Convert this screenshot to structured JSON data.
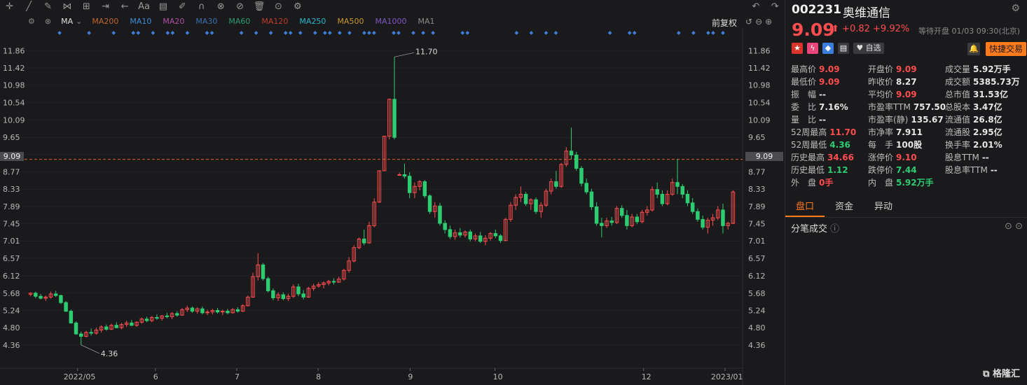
{
  "toolbar": {
    "icons": [
      "crosshair-icon",
      "line-tool-icon",
      "pen-tool-icon",
      "pattern-tool-icon",
      "measure-icon",
      "range-icon",
      "arrow-tool-icon",
      "text-tool-icon",
      "note-icon",
      "brush-icon",
      "magnet-icon",
      "link-icon",
      "hide-icon",
      "trash-icon",
      "compare-icon",
      "settings-icon"
    ],
    "text_label": "Aa"
  },
  "ma_bar": {
    "type_label": "MA",
    "items": [
      {
        "label": "MA200",
        "color": "#c0652e"
      },
      {
        "label": "MA10",
        "color": "#3e8fd6"
      },
      {
        "label": "MA20",
        "color": "#b04fa3"
      },
      {
        "label": "MA30",
        "color": "#3c6fb0"
      },
      {
        "label": "MA60",
        "color": "#2e9e6e"
      },
      {
        "label": "MA120",
        "color": "#c0392b"
      },
      {
        "label": "MA250",
        "color": "#2ab7c9"
      },
      {
        "label": "MA500",
        "color": "#c8962e"
      },
      {
        "label": "MA1000",
        "color": "#7e57c2"
      },
      {
        "label": "MA1",
        "color": "#8a8a8a"
      }
    ],
    "adjust_label": "前复权"
  },
  "chart_data": {
    "type": "candlestick",
    "title": "",
    "y_ticks": [
      11.86,
      11.42,
      10.98,
      10.54,
      10.09,
      9.65,
      9.21,
      8.77,
      8.33,
      7.89,
      7.45,
      7.01,
      6.57,
      6.12,
      5.68,
      5.24,
      4.8,
      4.36
    ],
    "ylim": [
      4.16,
      12.08
    ],
    "x_ticks": [
      "2022/05",
      "6",
      "7",
      "8",
      "9",
      "10",
      "12",
      "2023/01"
    ],
    "current_price_label": "9.09",
    "annotations": [
      {
        "label": "11.70"
      },
      {
        "label": "4.36"
      }
    ],
    "colors": {
      "up": "#ff4d4f",
      "down": "#2ecc71",
      "marker": "#3f7fd9",
      "grid": "#2a2a2e"
    },
    "ohlc": [
      [
        5.65,
        5.7,
        5.6,
        5.68
      ],
      [
        5.68,
        5.72,
        5.55,
        5.6
      ],
      [
        5.6,
        5.66,
        5.52,
        5.55
      ],
      [
        5.55,
        5.62,
        5.48,
        5.58
      ],
      [
        5.58,
        5.72,
        5.54,
        5.66
      ],
      [
        5.66,
        5.74,
        5.58,
        5.62
      ],
      [
        5.62,
        5.64,
        5.4,
        5.44
      ],
      [
        5.44,
        5.48,
        5.2,
        5.22
      ],
      [
        5.22,
        5.26,
        4.9,
        4.92
      ],
      [
        4.92,
        4.96,
        4.62,
        4.64
      ],
      [
        4.64,
        4.7,
        4.36,
        4.58
      ],
      [
        4.58,
        4.72,
        4.55,
        4.68
      ],
      [
        4.68,
        4.78,
        4.6,
        4.66
      ],
      [
        4.66,
        4.8,
        4.62,
        4.74
      ],
      [
        4.74,
        4.86,
        4.68,
        4.82
      ],
      [
        4.82,
        4.88,
        4.72,
        4.76
      ],
      [
        4.76,
        4.9,
        4.74,
        4.86
      ],
      [
        4.86,
        4.94,
        4.78,
        4.8
      ],
      [
        4.8,
        4.92,
        4.76,
        4.88
      ],
      [
        4.88,
        4.98,
        4.82,
        4.92
      ],
      [
        4.92,
        5.0,
        4.84,
        4.86
      ],
      [
        4.86,
        4.96,
        4.82,
        4.94
      ],
      [
        4.94,
        5.06,
        4.9,
        5.02
      ],
      [
        5.02,
        5.08,
        4.94,
        4.98
      ],
      [
        4.98,
        5.1,
        4.94,
        5.06
      ],
      [
        5.06,
        5.14,
        5.0,
        5.04
      ],
      [
        5.04,
        5.12,
        4.98,
        5.1
      ],
      [
        5.1,
        5.18,
        5.04,
        5.08
      ],
      [
        5.08,
        5.2,
        5.02,
        5.16
      ],
      [
        5.16,
        5.22,
        5.08,
        5.12
      ],
      [
        5.12,
        5.3,
        5.1,
        5.26
      ],
      [
        5.26,
        5.36,
        5.2,
        5.3
      ],
      [
        5.3,
        5.34,
        5.18,
        5.22
      ],
      [
        5.22,
        5.32,
        5.16,
        5.28
      ],
      [
        5.28,
        5.34,
        5.14,
        5.18
      ],
      [
        5.18,
        5.26,
        5.12,
        5.2
      ],
      [
        5.2,
        5.28,
        5.14,
        5.24
      ],
      [
        5.24,
        5.3,
        5.16,
        5.2
      ],
      [
        5.2,
        5.26,
        5.12,
        5.22
      ],
      [
        5.22,
        5.28,
        5.14,
        5.18
      ],
      [
        5.18,
        5.3,
        5.16,
        5.26
      ],
      [
        5.26,
        5.32,
        5.18,
        5.22
      ],
      [
        5.22,
        5.4,
        5.2,
        5.36
      ],
      [
        5.36,
        5.62,
        5.34,
        5.58
      ],
      [
        5.58,
        6.2,
        5.56,
        6.1
      ],
      [
        6.1,
        6.7,
        6.0,
        6.4
      ],
      [
        6.4,
        6.45,
        6.0,
        6.05
      ],
      [
        6.05,
        6.1,
        5.7,
        5.74
      ],
      [
        5.74,
        5.8,
        5.5,
        5.56
      ],
      [
        5.56,
        5.7,
        5.48,
        5.64
      ],
      [
        5.64,
        5.7,
        5.5,
        5.54
      ],
      [
        5.54,
        5.66,
        5.48,
        5.6
      ],
      [
        5.6,
        5.9,
        5.56,
        5.84
      ],
      [
        5.84,
        5.92,
        5.6,
        5.66
      ],
      [
        5.66,
        5.76,
        5.52,
        5.58
      ],
      [
        5.58,
        5.84,
        5.56,
        5.8
      ],
      [
        5.8,
        5.92,
        5.74,
        5.86
      ],
      [
        5.86,
        5.96,
        5.82,
        5.9
      ],
      [
        5.9,
        5.98,
        5.8,
        5.94
      ],
      [
        5.94,
        6.02,
        5.88,
        5.98
      ],
      [
        5.98,
        6.06,
        5.9,
        5.96
      ],
      [
        5.96,
        6.1,
        5.94,
        6.04
      ],
      [
        6.04,
        6.3,
        6.0,
        6.26
      ],
      [
        6.26,
        6.6,
        6.2,
        6.5
      ],
      [
        6.5,
        6.9,
        6.46,
        6.84
      ],
      [
        6.84,
        7.1,
        6.8,
        7.06
      ],
      [
        7.06,
        7.3,
        6.9,
        6.96
      ],
      [
        6.96,
        7.5,
        6.94,
        7.4
      ],
      [
        7.4,
        8.1,
        7.36,
        8.0
      ],
      [
        8.0,
        8.8,
        7.98,
        8.8
      ],
      [
        8.8,
        9.68,
        8.8,
        9.68
      ],
      [
        9.68,
        10.64,
        9.6,
        10.62
      ],
      [
        10.62,
        11.7,
        9.6,
        9.65
      ],
      [
        8.7,
        8.75,
        8.7,
        8.7
      ],
      [
        8.7,
        8.98,
        8.6,
        8.66
      ],
      [
        8.66,
        8.76,
        8.1,
        8.24
      ],
      [
        8.24,
        8.5,
        8.1,
        8.4
      ],
      [
        8.4,
        8.56,
        8.3,
        8.52
      ],
      [
        8.52,
        8.56,
        8.1,
        8.16
      ],
      [
        8.16,
        8.2,
        7.7,
        7.76
      ],
      [
        7.76,
        8.0,
        7.6,
        7.9
      ],
      [
        7.9,
        7.98,
        7.4,
        7.46
      ],
      [
        7.46,
        7.54,
        7.2,
        7.3
      ],
      [
        7.3,
        7.4,
        7.06,
        7.12
      ],
      [
        7.12,
        7.3,
        7.04,
        7.22
      ],
      [
        7.22,
        7.34,
        7.1,
        7.16
      ],
      [
        7.16,
        7.28,
        7.1,
        7.24
      ],
      [
        7.24,
        7.3,
        7.0,
        7.06
      ],
      [
        7.06,
        7.2,
        7.0,
        7.14
      ],
      [
        7.14,
        7.24,
        6.96,
        7.0
      ],
      [
        7.0,
        7.16,
        6.9,
        7.08
      ],
      [
        7.08,
        7.24,
        7.02,
        7.2
      ],
      [
        7.2,
        7.3,
        7.08,
        7.14
      ],
      [
        7.14,
        7.18,
        6.96,
        7.02
      ],
      [
        7.02,
        7.6,
        7.0,
        7.56
      ],
      [
        7.56,
        8.0,
        7.5,
        7.92
      ],
      [
        7.92,
        8.2,
        7.8,
        8.12
      ],
      [
        8.12,
        8.4,
        8.0,
        8.2
      ],
      [
        8.2,
        8.26,
        7.9,
        7.96
      ],
      [
        7.96,
        8.1,
        7.8,
        8.06
      ],
      [
        8.06,
        8.12,
        7.7,
        7.76
      ],
      [
        7.76,
        8.0,
        7.6,
        7.92
      ],
      [
        7.92,
        8.34,
        7.88,
        8.28
      ],
      [
        8.28,
        8.6,
        8.2,
        8.52
      ],
      [
        8.52,
        8.8,
        8.34,
        8.4
      ],
      [
        8.4,
        9.0,
        8.36,
        8.96
      ],
      [
        8.96,
        9.4,
        8.9,
        9.3
      ],
      [
        9.3,
        9.9,
        9.1,
        9.2
      ],
      [
        9.2,
        9.28,
        8.8,
        8.86
      ],
      [
        8.86,
        8.92,
        8.4,
        8.48
      ],
      [
        8.48,
        8.6,
        8.2,
        8.26
      ],
      [
        8.26,
        8.34,
        7.8,
        7.88
      ],
      [
        7.88,
        8.0,
        7.4,
        7.46
      ],
      [
        7.46,
        7.6,
        7.1,
        7.4
      ],
      [
        7.4,
        7.6,
        7.34,
        7.52
      ],
      [
        7.52,
        7.62,
        7.4,
        7.48
      ],
      [
        7.48,
        7.9,
        7.44,
        7.84
      ],
      [
        7.84,
        7.92,
        7.6,
        7.66
      ],
      [
        7.66,
        7.8,
        7.3,
        7.4
      ],
      [
        7.4,
        7.7,
        7.36,
        7.62
      ],
      [
        7.62,
        7.7,
        7.44,
        7.5
      ],
      [
        7.5,
        7.8,
        7.46,
        7.74
      ],
      [
        7.74,
        7.9,
        7.66,
        7.8
      ],
      [
        7.8,
        8.4,
        7.76,
        8.32
      ],
      [
        8.32,
        8.5,
        8.1,
        8.2
      ],
      [
        8.2,
        8.3,
        7.9,
        7.96
      ],
      [
        7.96,
        8.3,
        7.92,
        8.2
      ],
      [
        8.2,
        8.6,
        8.16,
        8.5
      ],
      [
        8.5,
        9.1,
        8.2,
        8.4
      ],
      [
        8.4,
        8.46,
        8.1,
        8.2
      ],
      [
        8.2,
        8.3,
        7.9,
        7.98
      ],
      [
        7.98,
        8.1,
        7.7,
        7.76
      ],
      [
        7.76,
        7.84,
        7.5,
        7.56
      ],
      [
        7.56,
        7.66,
        7.3,
        7.36
      ],
      [
        7.36,
        7.6,
        7.2,
        7.54
      ],
      [
        7.54,
        7.7,
        7.4,
        7.6
      ],
      [
        7.6,
        7.9,
        7.54,
        7.8
      ],
      [
        7.8,
        7.96,
        7.2,
        7.4
      ],
      [
        7.4,
        7.5,
        7.3,
        7.46
      ],
      [
        7.46,
        8.3,
        7.44,
        8.26
      ]
    ]
  },
  "quote": {
    "code": "002231",
    "name": "奥维通信",
    "price": "9.09",
    "arrow": "⬆",
    "change": "+0.82",
    "change_pct": "+9.92%",
    "status": "等待开盘 01/03 09:30(北京)",
    "favorite_label": "自选",
    "quick_trade_label": "快捷交易",
    "stats": [
      [
        {
          "k": "最高价",
          "v": "9.09",
          "c": "red"
        },
        {
          "k": "开盘价",
          "v": "9.09",
          "c": "red"
        },
        {
          "k": "成交量",
          "v": "5.92万手",
          "c": "white"
        }
      ],
      [
        {
          "k": "最低价",
          "v": "9.09",
          "c": "red"
        },
        {
          "k": "昨收价",
          "v": "8.27",
          "c": "white"
        },
        {
          "k": "成交额",
          "v": "5385.73万",
          "c": "white"
        }
      ],
      [
        {
          "k": "振　幅",
          "v": "--",
          "c": "white"
        },
        {
          "k": "平均价",
          "v": "9.09",
          "c": "red"
        },
        {
          "k": "总市值",
          "v": "31.53亿",
          "c": "white"
        }
      ],
      [
        {
          "k": "委　比",
          "v": "7.16%",
          "c": "white"
        },
        {
          "k": "市盈率TTM",
          "v": "757.50",
          "c": "white"
        },
        {
          "k": "总股本",
          "v": "3.47亿",
          "c": "white"
        }
      ],
      [
        {
          "k": "量　比",
          "v": "--",
          "c": "white"
        },
        {
          "k": "市盈率(静)",
          "v": "135.67",
          "c": "white"
        },
        {
          "k": "流通值",
          "v": "26.8亿",
          "c": "white"
        }
      ],
      [
        {
          "k": "52周最高",
          "v": "11.70",
          "c": "red"
        },
        {
          "k": "市净率",
          "v": "7.911",
          "c": "white"
        },
        {
          "k": "流通股",
          "v": "2.95亿",
          "c": "white"
        }
      ],
      [
        {
          "k": "52周最低",
          "v": "4.36",
          "c": "green"
        },
        {
          "k": "每　手",
          "v": "100股",
          "c": "white"
        },
        {
          "k": "换手率",
          "v": "2.01%",
          "c": "white"
        }
      ],
      [
        {
          "k": "历史最高",
          "v": "34.66",
          "c": "red"
        },
        {
          "k": "涨停价",
          "v": "9.10",
          "c": "red"
        },
        {
          "k": "股息TTM",
          "v": "--",
          "c": "white"
        }
      ],
      [
        {
          "k": "历史最低",
          "v": "1.12",
          "c": "green"
        },
        {
          "k": "跌停价",
          "v": "7.44",
          "c": "green"
        },
        {
          "k": "股息率TTM",
          "v": "--",
          "c": "white"
        }
      ],
      [
        {
          "k": "外　盘",
          "v": "0手",
          "c": "red"
        },
        {
          "k": "内　盘",
          "v": "5.92万手",
          "c": "green"
        },
        {
          "k": "",
          "v": "",
          "c": "white"
        }
      ]
    ]
  },
  "tabs": [
    "盘口",
    "资金",
    "异动"
  ],
  "trades_title": "分笔成交",
  "brand": "格隆汇"
}
